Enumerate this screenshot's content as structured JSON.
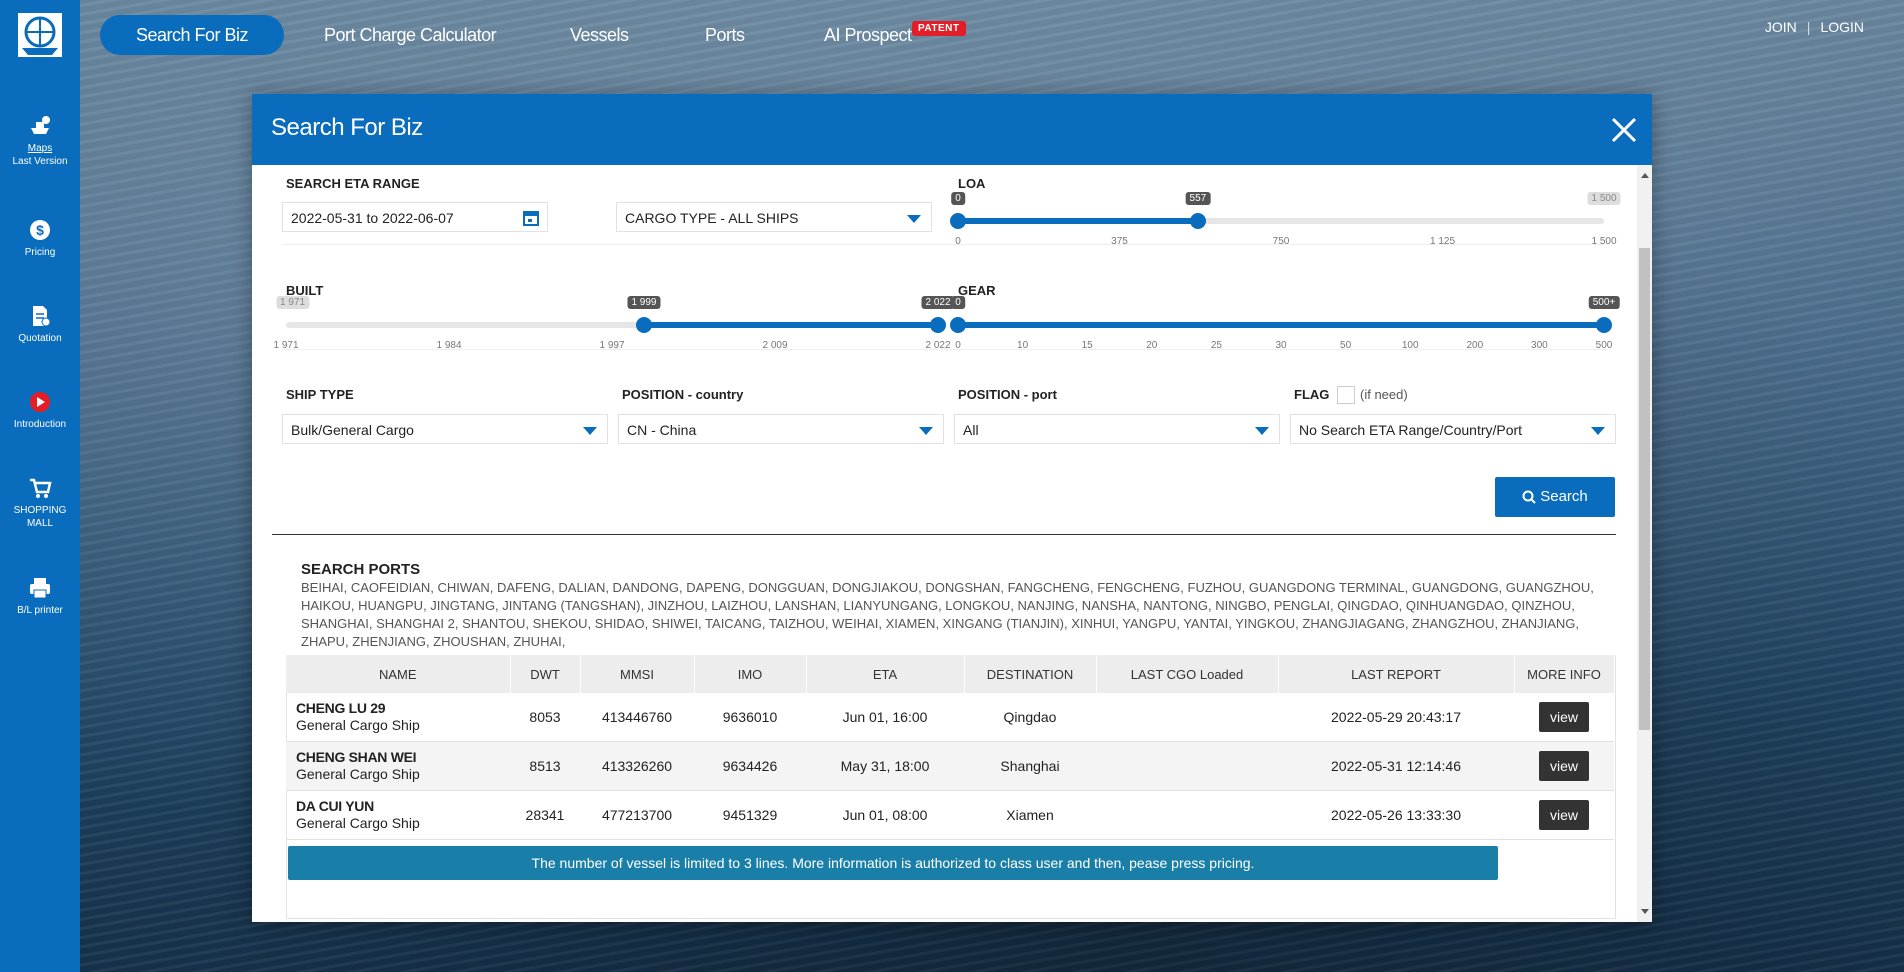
{
  "sidebar": {
    "items": [
      {
        "label": "Maps",
        "sub": "Last Version",
        "icon": "ship-map-icon"
      },
      {
        "label": "Pricing",
        "icon": "dollar-icon"
      },
      {
        "label": "Quotation",
        "icon": "quotation-icon"
      },
      {
        "label": "Introduction",
        "icon": "play-icon"
      },
      {
        "label": "SHOPPING MALL",
        "icon": "cart-icon"
      },
      {
        "label": "B/L printer",
        "icon": "printer-icon"
      }
    ]
  },
  "nav": {
    "items": [
      "Search For Biz",
      "Port Charge Calculator",
      "Vessels",
      "Ports",
      "AI Prospect"
    ],
    "patent_badge": "PATENT",
    "join": "JOIN",
    "separator": "|",
    "login": "LOGIN"
  },
  "modal": {
    "title": "Search For Biz",
    "eta": {
      "label": "SEARCH ETA RANGE",
      "value": "2022-05-31 to 2022-06-07"
    },
    "cargo": {
      "value": "CARGO TYPE - ALL SHIPS"
    },
    "loa": {
      "label": "LOA",
      "min": 0,
      "max": 1500,
      "low": 0,
      "high": 557,
      "low_label": "0",
      "high_label": "557",
      "max_label": "1 500",
      "ticks": [
        "0",
        "375",
        "750",
        "1 125",
        "1 500"
      ]
    },
    "built": {
      "label": "BUILT",
      "min": 1971,
      "max": 2022,
      "low": 1999,
      "high": 2022,
      "min_label": "1 971",
      "low_label": "1 999",
      "high_label": "2 022",
      "ticks": [
        "1 971",
        "1 984",
        "1 997",
        "2 009",
        "2 022"
      ]
    },
    "gear": {
      "label": "GEAR",
      "low": 0,
      "high": "500+",
      "low_label": "0",
      "high_label": "500+",
      "ticks": [
        "0",
        "10",
        "15",
        "20",
        "25",
        "30",
        "50",
        "100",
        "200",
        "300",
        "500"
      ]
    },
    "ship_type": {
      "label": "SHIP TYPE",
      "value": "Bulk/General Cargo"
    },
    "position_country": {
      "label": "POSITION - country",
      "value": "CN - China"
    },
    "position_port": {
      "label": "POSITION - port",
      "value": "All"
    },
    "flag": {
      "label": "FLAG",
      "note": "(if need)",
      "value": "No Search ETA Range/Country/Port"
    },
    "search_button": "Search",
    "ports": {
      "title": "SEARCH PORTS",
      "list": "BEIHAI, CAOFEIDIAN, CHIWAN, DAFENG, DALIAN, DANDONG, DAPENG, DONGGUAN, DONGJIAKOU, DONGSHAN, FANGCHENG, FENGCHENG, FUZHOU, GUANGDONG TERMINAL, GUANGDONG, GUANGZHOU, HAIKOU, HUANGPU, JINGTANG, JINTANG (TANGSHAN), JINZHOU, LAIZHOU, LANSHAN, LIANYUNGANG, LONGKOU, NANJING, NANSHA, NANTONG, NINGBO, PENGLAI, QINGDAO, QINHUANGDAO, QINZHOU, SHANGHAI, SHANGHAI 2, SHANTOU, SHEKOU, SHIDAO, SHIWEI, TAICANG, TAIZHOU, WEIHAI, XIAMEN, XINGANG (TIANJIN), XINHUI, YANGPU, YANTAI, YINGKOU, ZHANGJIAGANG, ZHANGZHOU, ZHANJIANG, ZHAPU, ZHENJIANG, ZHOUSHAN, ZHUHAI,"
    },
    "table": {
      "headers": [
        "NAME",
        "DWT",
        "MMSI",
        "IMO",
        "ETA",
        "DESTINATION",
        "LAST CGO Loaded",
        "LAST REPORT",
        "MORE INFO"
      ],
      "rows": [
        {
          "name": "CHENG LU 29",
          "type": "General Cargo Ship",
          "dwt": "8053",
          "mmsi": "413446760",
          "imo": "9636010",
          "eta": "Jun 01, 16:00",
          "destination": "Qingdao",
          "last_cgo": "",
          "last_report": "2022-05-29 20:43:17",
          "action": "view"
        },
        {
          "name": "CHENG SHAN WEI",
          "type": "General Cargo Ship",
          "dwt": "8513",
          "mmsi": "413326260",
          "imo": "9634426",
          "eta": "May 31, 18:00",
          "destination": "Shanghai",
          "last_cgo": "",
          "last_report": "2022-05-31 12:14:46",
          "action": "view"
        },
        {
          "name": "DA CUI YUN",
          "type": "General Cargo Ship",
          "dwt": "28341",
          "mmsi": "477213700",
          "imo": "9451329",
          "eta": "Jun 01, 08:00",
          "destination": "Xiamen",
          "last_cgo": "",
          "last_report": "2022-05-26 13:33:30",
          "action": "view"
        }
      ]
    },
    "notice": "The number of vessel is limited to 3 lines. More information is authorized to class user and then, pease press pricing."
  },
  "colors": {
    "brand": "#0a6cbd",
    "notice": "#1a7fa8",
    "patent": "#e41e26",
    "button_dark": "#333333"
  }
}
